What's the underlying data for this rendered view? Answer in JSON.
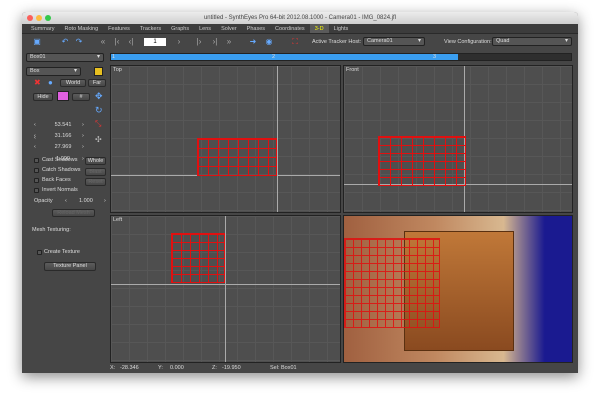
{
  "window": {
    "title": "untitled - SynthEyes Pro 64-bit 2012.08.1000 - Camera01 - IMG_0824.jfl"
  },
  "tabs": [
    "Summary",
    "Roto Masking",
    "Features",
    "Trackers",
    "Graphs",
    "Lens",
    "Solver",
    "Phases",
    "Coordinates",
    "3-D",
    "Lights"
  ],
  "active_tab": "3-D",
  "toolbar": {
    "frame": "1",
    "active_tracker_host_label": "Active Tracker Host:",
    "active_tracker_host": "Camera01",
    "view_configuration_label": "View Configuration:",
    "view_configuration": "Quad"
  },
  "timeline": {
    "object": "Box01",
    "start": "1",
    "end": "2",
    "end2": "3",
    "progress": 1.0
  },
  "panel": {
    "shape": "Box",
    "world": "World",
    "far": "Far",
    "hide": "Hide",
    "hash": "#",
    "color": "#e060e0",
    "values": [
      "53.541",
      "31.166",
      "27.969",
      "1.000"
    ],
    "cast_shadows": "Cast Shadows",
    "catch_shadows": "Catch Shadows",
    "back_faces": "Back Faces",
    "invert_normals": "Invert Normals",
    "whole": "Whole",
    "blast": "Blast",
    "reset": "Reset",
    "opacity_label": "Opacity",
    "opacity": "1.000",
    "reload_mesh": "Reload Mesh",
    "mesh_texturing": "Mesh Texturing:",
    "create_texture": "Create Texture",
    "texture_panel": "Texture Panel"
  },
  "viewports": {
    "top": "Top",
    "front": "Front",
    "left": "Left"
  },
  "status": {
    "x_label": "X:",
    "x": "-28.346",
    "y_label": "Y:",
    "y": "0.000",
    "z_label": "Z:",
    "z": "-19.950",
    "sel": "Sel: Box01"
  },
  "colors": {
    "accent": "#3a9ef0",
    "mesh": "#e01010",
    "active_tab_text": "#ffff00"
  }
}
